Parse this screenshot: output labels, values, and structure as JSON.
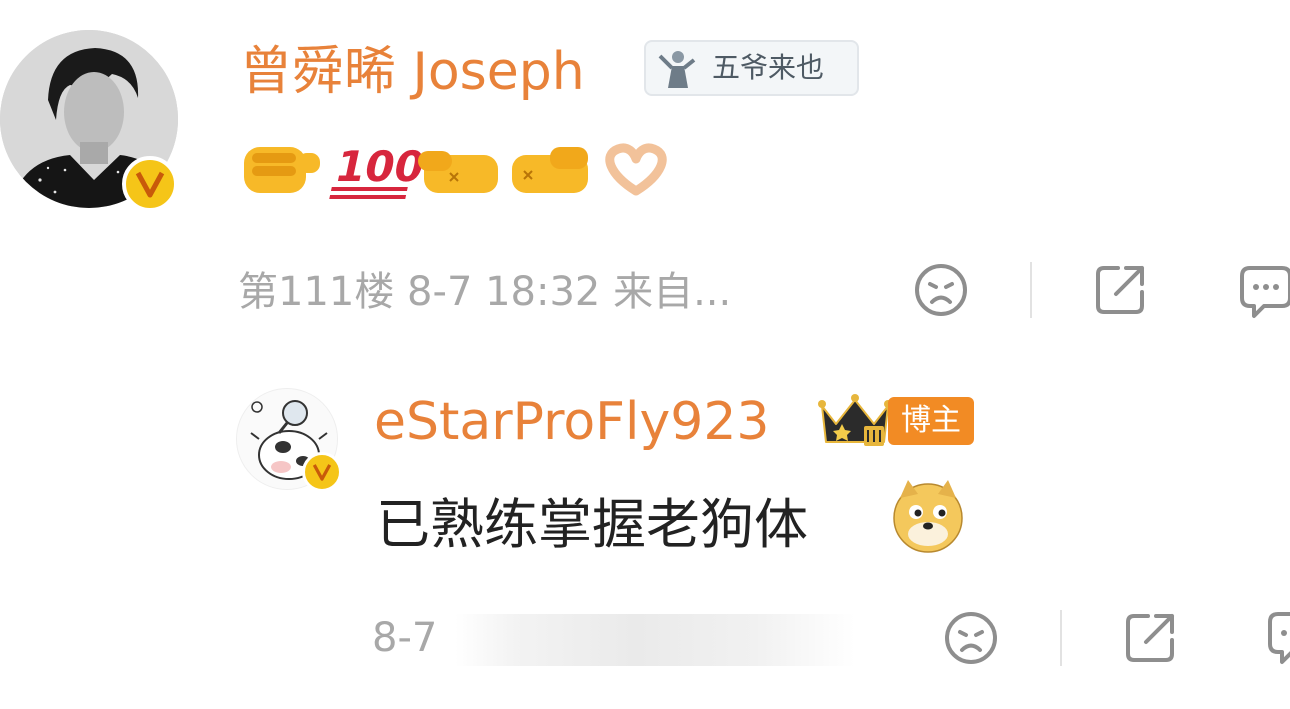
{
  "comment": {
    "author": "曾舜晞 Joseph",
    "medal_label": "五爷来也",
    "emojis": [
      "pointing-fist-emoji",
      "hundred-points-emoji",
      "left-facing-fist-emoji",
      "right-facing-fist-emoji",
      "heart-hands-emoji"
    ],
    "meta": "第111楼 8-7 18:32 来自...",
    "actions": [
      "dislike-icon",
      "share-icon",
      "comment-icon"
    ]
  },
  "reply": {
    "author": "eStarProFly923",
    "tag": "博主",
    "text": "已熟练掌握老狗体",
    "emoji": "doge-emoji",
    "date": "8-7",
    "actions": [
      "dislike-icon",
      "share-icon",
      "comment-icon"
    ]
  },
  "colors": {
    "username": "#e8823a",
    "meta": "#a8a8a8",
    "tag_bg": "#f28b24",
    "verify": "#f5c518"
  }
}
